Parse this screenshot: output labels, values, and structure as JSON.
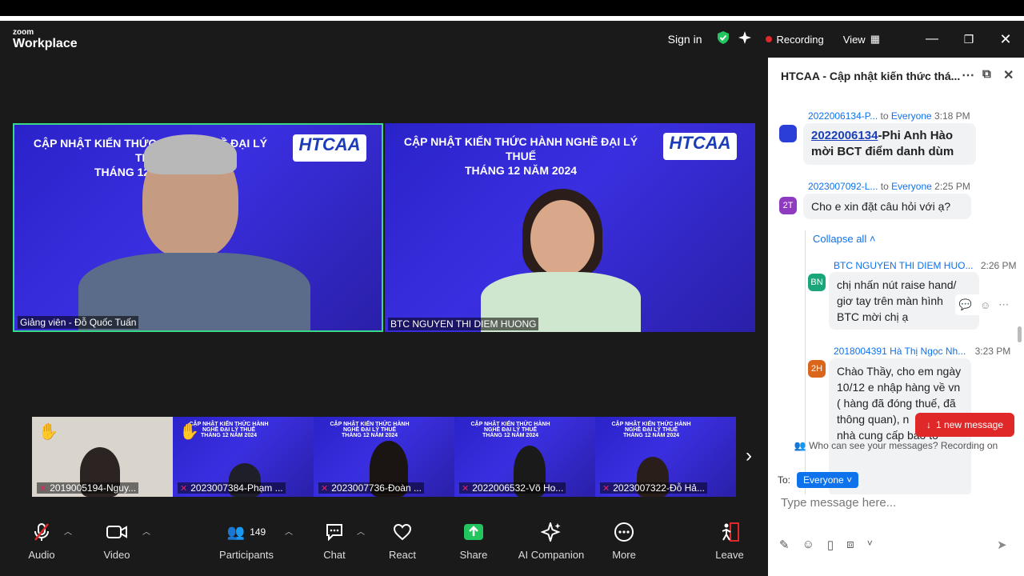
{
  "titlebar": {
    "logo_top": "zoom",
    "logo_bottom": "Workplace",
    "signin": "Sign in",
    "recording": "Recording",
    "view": "View"
  },
  "banner": {
    "line1": "CẬP NHẬT KIẾN THỨC HÀNH NGHỀ ĐẠI LÝ THUẾ",
    "line2": "THÁNG 12 NĂM 2024",
    "logo": "HTCAA",
    "logo_sub": "HỘI TƯ VẤN VÀ ĐẠI LÝ THUẾ TP.HCM"
  },
  "speaker": {
    "tile1_name": "Giảng viên - Đỗ Quốc Tuấn",
    "tile2_name": "BTC NGUYEN THI DIEM HUONG"
  },
  "thumbs": [
    {
      "name": "2019005194-Nguy..."
    },
    {
      "name": "2023007384-Phạm ..."
    },
    {
      "name": "2023007736-Đoàn ..."
    },
    {
      "name": "2022006532-Võ Ho..."
    },
    {
      "name": "2023007322-Đỗ Hả..."
    }
  ],
  "toolbar": {
    "audio": "Audio",
    "video": "Video",
    "participants": "Participants",
    "participant_count": "149",
    "chat": "Chat",
    "react": "React",
    "share": "Share",
    "ai": "AI Companion",
    "more": "More",
    "leave": "Leave"
  },
  "chat": {
    "title": "HTCAA - Cập nhật kiến thức thá...",
    "m1": {
      "from": "2022006134-P...",
      "to": "to",
      "target": "Everyone",
      "time": "3:18 PM",
      "link": "2022006134",
      "text1": "-Phi Anh Hào",
      "text2": "mời  BCT điểm danh dùm"
    },
    "m2": {
      "avatar": "2T",
      "from": "2023007092-L...",
      "to": "to",
      "target": "Everyone",
      "time": "2:25 PM",
      "text": "Cho e xin đặt câu hỏi với ạ?"
    },
    "collapse": "Collapse all",
    "r1": {
      "avatar": "BN",
      "from": "BTC NGUYEN THI DIEM HUO...",
      "time": "2:26 PM",
      "l1": "chị nhấn nút raise hand/",
      "l2": "giơ tay trên màn hình",
      "l3": "BTC mời chị ạ"
    },
    "r2": {
      "avatar": "2H",
      "from": "2018004391 Hà Thị Ngọc Nh...",
      "time": "3:23 PM",
      "l1": "Chào Thầy, cho em ngày",
      "l2": "10/12 e nhập hàng về vn",
      "l3": "( hàng đã đóng thuế, đã",
      "l4": "thông quan), n",
      "l5": "nhà cung cấp báo to"
    },
    "new_message": "1 new message",
    "who_can_see": "Who can see your messages? Recording on",
    "to_label": "To:",
    "to_value": "Everyone",
    "placeholder": "Type message here..."
  }
}
